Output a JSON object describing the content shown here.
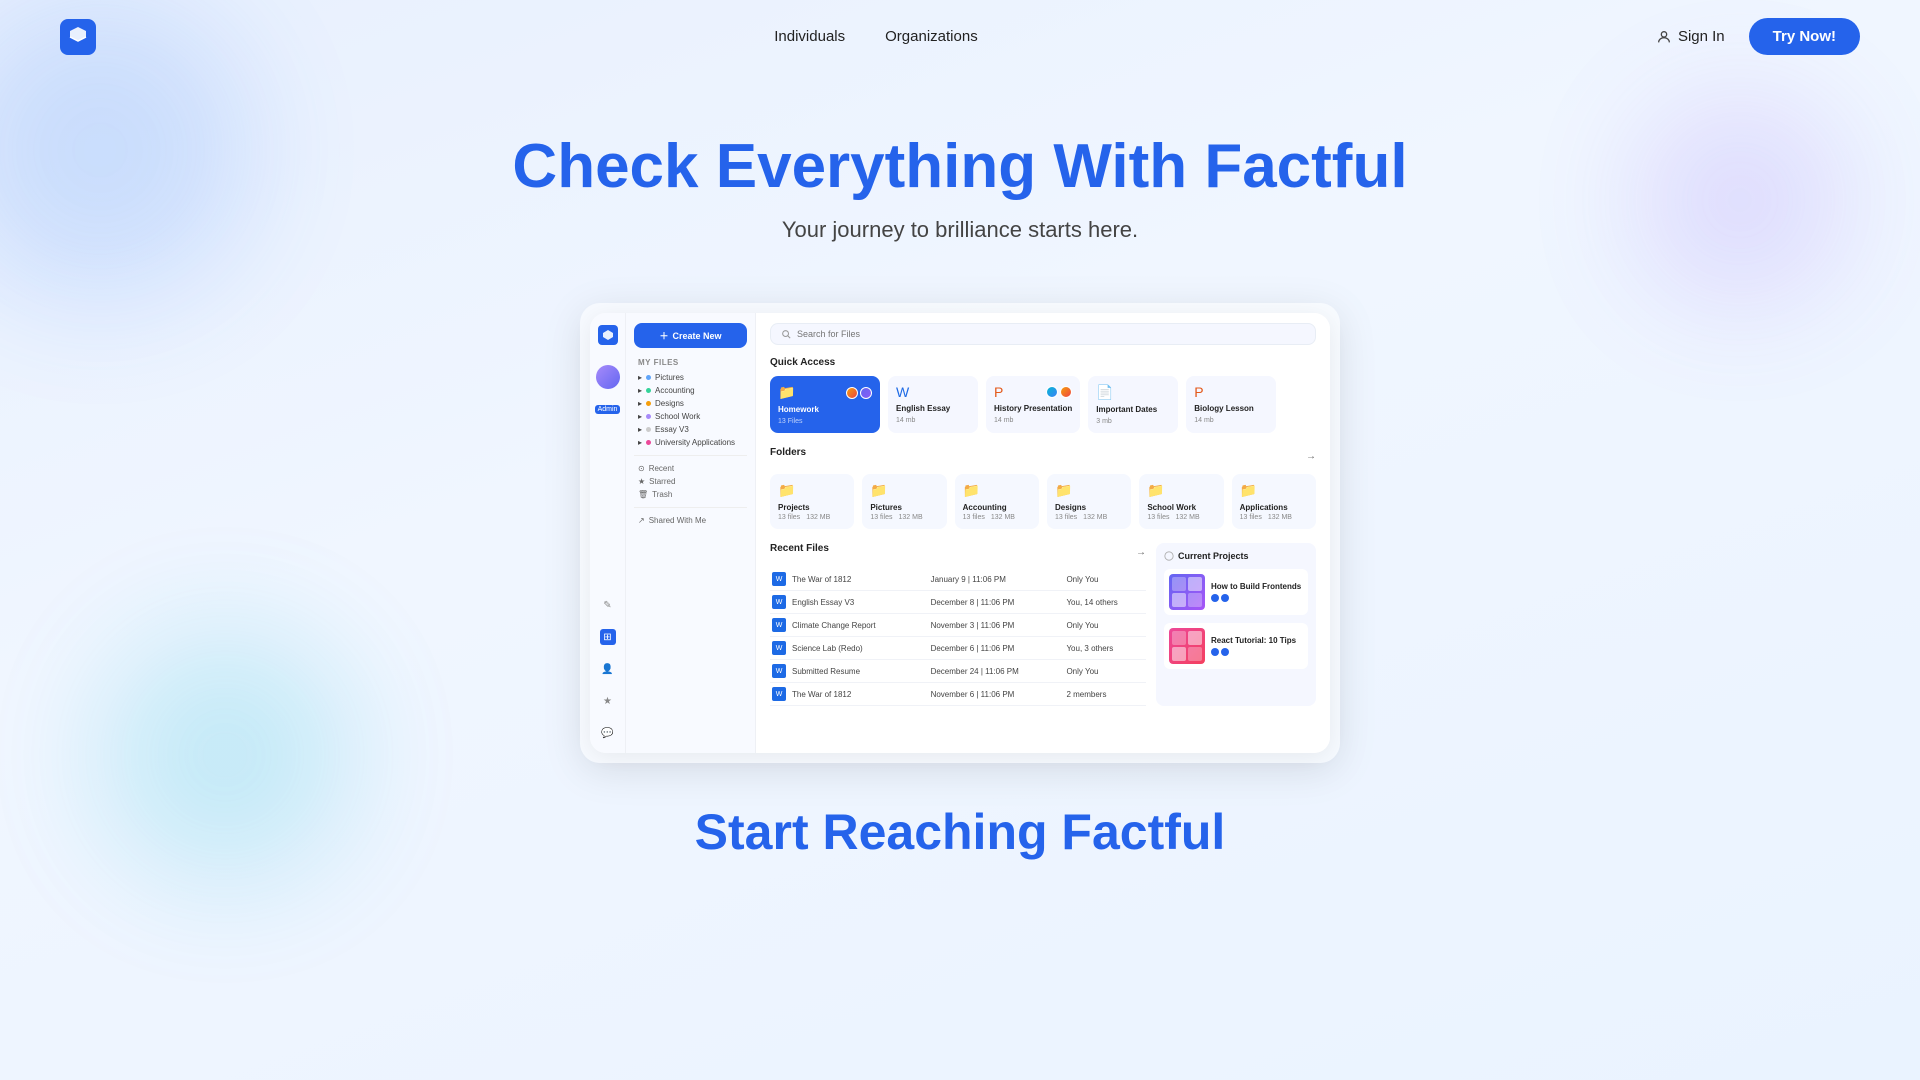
{
  "brand": {
    "name": "Factful",
    "logo_color": "#2563eb"
  },
  "nav": {
    "links": [
      "Individuals",
      "Organizations"
    ],
    "sign_in_label": "Sign In",
    "try_now_label": "Try Now!"
  },
  "hero": {
    "headline_part1": "Check Everything With ",
    "headline_brand": "Factful",
    "subheadline": "Your journey to brilliance starts here."
  },
  "app": {
    "create_btn": "Create New",
    "search_placeholder": "Search for Files",
    "sidebar": {
      "section_title": "My Files",
      "items": [
        {
          "label": "Pictures"
        },
        {
          "label": "Accounting"
        },
        {
          "label": "Designs"
        },
        {
          "label": "School Work"
        },
        {
          "label": "Essay V3"
        },
        {
          "label": "University Applications"
        }
      ],
      "bottom_items": [
        {
          "label": "Recent"
        },
        {
          "label": "Starred"
        },
        {
          "label": "Trash"
        },
        {
          "label": "Shared With Me"
        }
      ]
    },
    "quick_access": {
      "label": "Quick Access",
      "items": [
        {
          "name": "Homework",
          "size": "13 Files",
          "type": "folder",
          "featured": true
        },
        {
          "name": "English Essay",
          "size": "14 mb",
          "type": "word"
        },
        {
          "name": "History Presentation",
          "size": "14 mb",
          "type": "ppt"
        },
        {
          "name": "Important Dates",
          "size": "3 mb",
          "type": "doc"
        },
        {
          "name": "Biology Lesson",
          "size": "14 mb",
          "type": "ppt"
        }
      ]
    },
    "folders": {
      "label": "Folders",
      "arrow": "→",
      "items": [
        {
          "name": "Projects",
          "files": "13 files",
          "size": "132 MB"
        },
        {
          "name": "Pictures",
          "files": "13 files",
          "size": "132 MB"
        },
        {
          "name": "Accounting",
          "files": "13 files",
          "size": "132 MB"
        },
        {
          "name": "Designs",
          "files": "13 files",
          "size": "132 MB"
        },
        {
          "name": "School Work",
          "files": "13 files",
          "size": "132 MB"
        },
        {
          "name": "Applications",
          "files": "13 files",
          "size": "132 MB"
        }
      ]
    },
    "recent_files": {
      "label": "Recent Files",
      "arrow": "→",
      "rows": [
        {
          "name": "The War of 1812",
          "date": "January 9 | 11:06 PM",
          "shared": "Only You"
        },
        {
          "name": "English Essay V3",
          "date": "December 8 | 11:06 PM",
          "shared": "You, 14 others"
        },
        {
          "name": "Climate Change Report",
          "date": "November 3 | 11:06 PM",
          "shared": "Only You"
        },
        {
          "name": "Science Lab (Redo)",
          "date": "December 6 | 11:06 PM",
          "shared": "You, 3 others"
        },
        {
          "name": "Submitted Resume",
          "date": "December 24 | 11:06 PM",
          "shared": "Only You"
        },
        {
          "name": "The War of 1812",
          "date": "November 6 | 11:06 PM",
          "shared": "2 members"
        }
      ]
    },
    "current_projects": {
      "label": "Current Projects",
      "items": [
        {
          "name": "How to Build Frontends",
          "thumb_style": "purple"
        },
        {
          "name": "React Tutorial: 10 Tips",
          "thumb_style": "pink"
        }
      ]
    }
  },
  "bottom_teaser": {
    "text_part1": "Start Reaching ",
    "text_brand": "Factful"
  }
}
